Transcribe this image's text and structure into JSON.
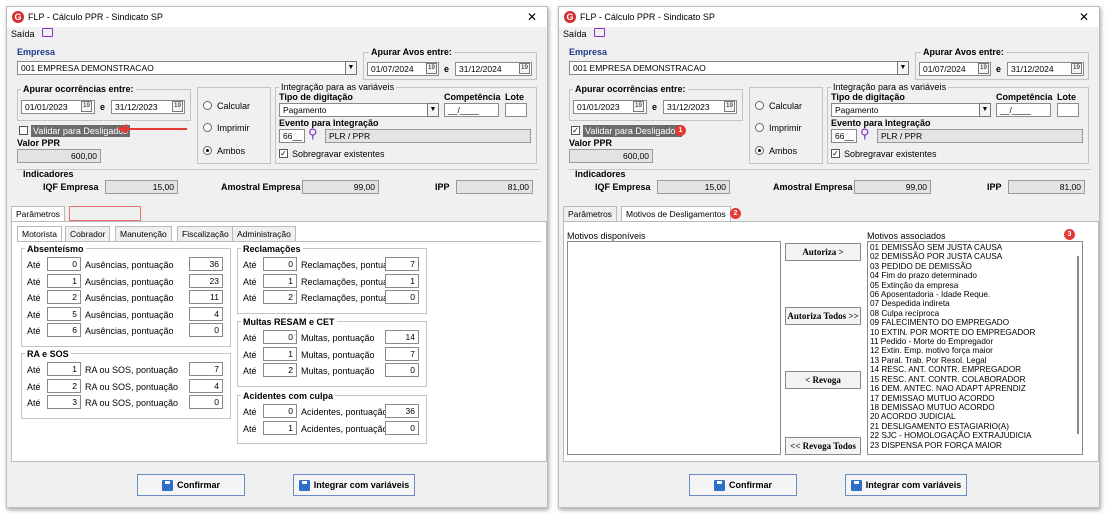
{
  "window": {
    "title": "FLP - Cálculo PPR - Sindicato SP",
    "menu_saida": "Saída",
    "logo_letter": "G"
  },
  "empresa": {
    "label": "Empresa",
    "value": "001 EMPRESA DEMONSTRACAO"
  },
  "avos": {
    "label": "Apurar Avos entre:",
    "start": "01/07/2024",
    "e": "e",
    "end": "31/12/2024"
  },
  "ocorrencias": {
    "label": "Apurar ocorrências entre:",
    "start": "01/01/2023",
    "e": "e",
    "end": "31/12/2023"
  },
  "radios": {
    "calcular": "Calcular",
    "imprimir": "Imprimir",
    "ambos": "Ambos"
  },
  "integracao": {
    "label": "Integração para as variáveis",
    "tipo_label": "Tipo de digitação",
    "tipo_value": "Pagamento",
    "competencia_label": "Competência",
    "competencia_value": "__/____",
    "lote_label": "Lote",
    "evento_label": "Evento para Integração",
    "evento_code": "66__",
    "evento_desc": "PLR / PPR",
    "sobregravar": "Sobregravar existentes"
  },
  "validar": "Validar para Desligados",
  "valor_ppr": {
    "label": "Valor PPR",
    "value": "600,00"
  },
  "indicadores": {
    "label": "Indicadores",
    "iqf_label": "IQF Empresa",
    "iqf_value": "15,00",
    "amostral_label": "Amostral Empresa",
    "amostral_value": "99,00",
    "ipp_label": "IPP",
    "ipp_value": "81,00"
  },
  "tabs": {
    "parametros": "Parâmetros",
    "motivos": "Motivos de Desligamentos"
  },
  "subtabs": [
    "Motorista",
    "Cobrador",
    "Manutenção",
    "Fiscalização",
    "Administração"
  ],
  "ate": "Até",
  "absenteismo": {
    "title": "Absenteísmo",
    "desc": "Ausências, pontuação",
    "rows": [
      {
        "n": "0",
        "p": "36"
      },
      {
        "n": "1",
        "p": "23"
      },
      {
        "n": "2",
        "p": "11"
      },
      {
        "n": "5",
        "p": "4"
      },
      {
        "n": "6",
        "p": "0"
      }
    ]
  },
  "ra_sos": {
    "title": "RA e SOS",
    "desc": "RA ou SOS, pontuação",
    "rows": [
      {
        "n": "1",
        "p": "7"
      },
      {
        "n": "2",
        "p": "4"
      },
      {
        "n": "3",
        "p": "0"
      }
    ]
  },
  "reclamacoes": {
    "title": "Reclamações",
    "desc": "Reclamações, pontuação",
    "rows": [
      {
        "n": "0",
        "p": "7"
      },
      {
        "n": "1",
        "p": "1"
      },
      {
        "n": "2",
        "p": "0"
      }
    ]
  },
  "multas": {
    "title": "Multas RESAM e CET",
    "desc": "Multas, pontuação",
    "rows": [
      {
        "n": "0",
        "p": "14"
      },
      {
        "n": "1",
        "p": "7"
      },
      {
        "n": "2",
        "p": "0"
      }
    ]
  },
  "acidentes": {
    "title": "Acidentes com culpa",
    "desc": "Acidentes, pontuação",
    "rows": [
      {
        "n": "0",
        "p": "36"
      },
      {
        "n": "1",
        "p": "0"
      }
    ]
  },
  "motivos_panel": {
    "disponiveis": "Motivos disponíveis",
    "associados": "Motivos associados",
    "autoriza": "Autoriza >",
    "autoriza_todos": "Autoriza Todos >>",
    "revoga": "< Revoga",
    "revoga_todos": "<< Revoga Todos",
    "items": [
      "01 DEMISSÃO SEM JUSTA CAUSA",
      "02 DEMISSÃO POR JUSTA CAUSA",
      "03 PEDIDO DE DEMISSÃO",
      "04 Fim do prazo determinado",
      "05 Extinção da empresa",
      "06 Aposentadoria - Idade Reque.",
      "07 Despedida indireta",
      "08 Culpa recíproca",
      "09 FALECIMENTO DO EMPREGADO",
      "10 EXTIN. POR MORTE DO EMPREGADOR",
      "11 Pedido - Morte do Empregador",
      "12 Extin. Emp. motivo força maior",
      "13 Paral. Trab. Por Resol. Legal",
      "14 RESC. ANT. CONTR. EMPREGADOR",
      "15 RESC. ANT. CONTR. COLABORADOR",
      "16 DEM. ANTEC. NAO ADAPT APRENDIZ",
      "17 DEMISSAO MUTUO ACORDO",
      "18 DEMISSAO MUTUO ACORDO",
      "20 ACORDO JUDICIAL",
      "21 DESLIGAMENTO ESTAGIARIO(A)",
      "22 SJC - HOMOLOGAÇÃO EXTRAJUDICIA",
      "23 DISPENSA POR FORÇA MAIOR"
    ]
  },
  "buttons": {
    "confirmar": "Confirmar",
    "integrar": "Integrar com variáveis"
  },
  "badges": [
    "1",
    "2",
    "3"
  ],
  "colors": {
    "accent": "#1f3b8a",
    "badge": "#e53935",
    "arrow": "#e53935",
    "logo": "#d32f2f"
  }
}
